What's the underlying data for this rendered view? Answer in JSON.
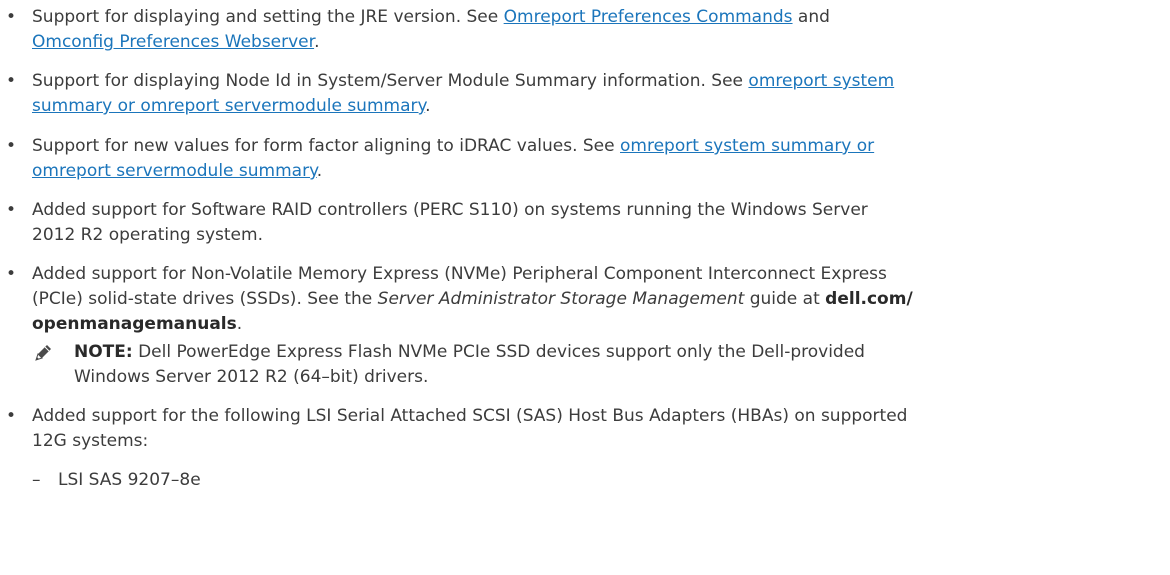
{
  "items": [
    {
      "pre": "Support for displaying and setting the JRE version. See ",
      "link1": "Omreport Preferences Commands",
      "mid": " and",
      "link2": "Omconfig Preferences Webserver",
      "post": "."
    },
    {
      "pre": "Support for displaying Node Id in System/Server Module Summary information. See ",
      "link1": "omreport system",
      "link2": "summary or omreport servermodule summary",
      "post": "."
    },
    {
      "pre": "Support for new values for form factor aligning to iDRAC values. See ",
      "link1": "omreport system summary or",
      "link2": "omreport servermodule summary",
      "post": "."
    },
    {
      "line1": "Added support for Software RAID controllers (PERC S110) on systems running the Windows Server",
      "line2": "2012 R2 operating system."
    },
    {
      "line1": "Added support for Non-Volatile Memory Express (NVMe) Peripheral Component Interconnect Express",
      "line2_pre": "(PCIe) solid-state drives (SSDs). See the ",
      "line2_ital": "Server Administrator Storage Management",
      "line2_mid": " guide at ",
      "line2_bold": "dell.com/",
      "line3_bold": "openmanagemanuals",
      "line3_post": "."
    },
    {
      "line1": "Added support for the following LSI Serial Attached SCSI (SAS) Host Bus Adapters (HBAs) on supported",
      "line2": "12G systems:"
    }
  ],
  "note": {
    "label": "NOTE:",
    "line1": " Dell PowerEdge Express Flash NVMe PCIe SSD devices support only the Dell-provided",
    "line2": "Windows Server 2012 R2 (64–bit) drivers."
  },
  "sub_items": [
    {
      "text": "LSI SAS 9207–8e"
    }
  ],
  "symbols": {
    "bullet": "•",
    "dash": "–"
  }
}
